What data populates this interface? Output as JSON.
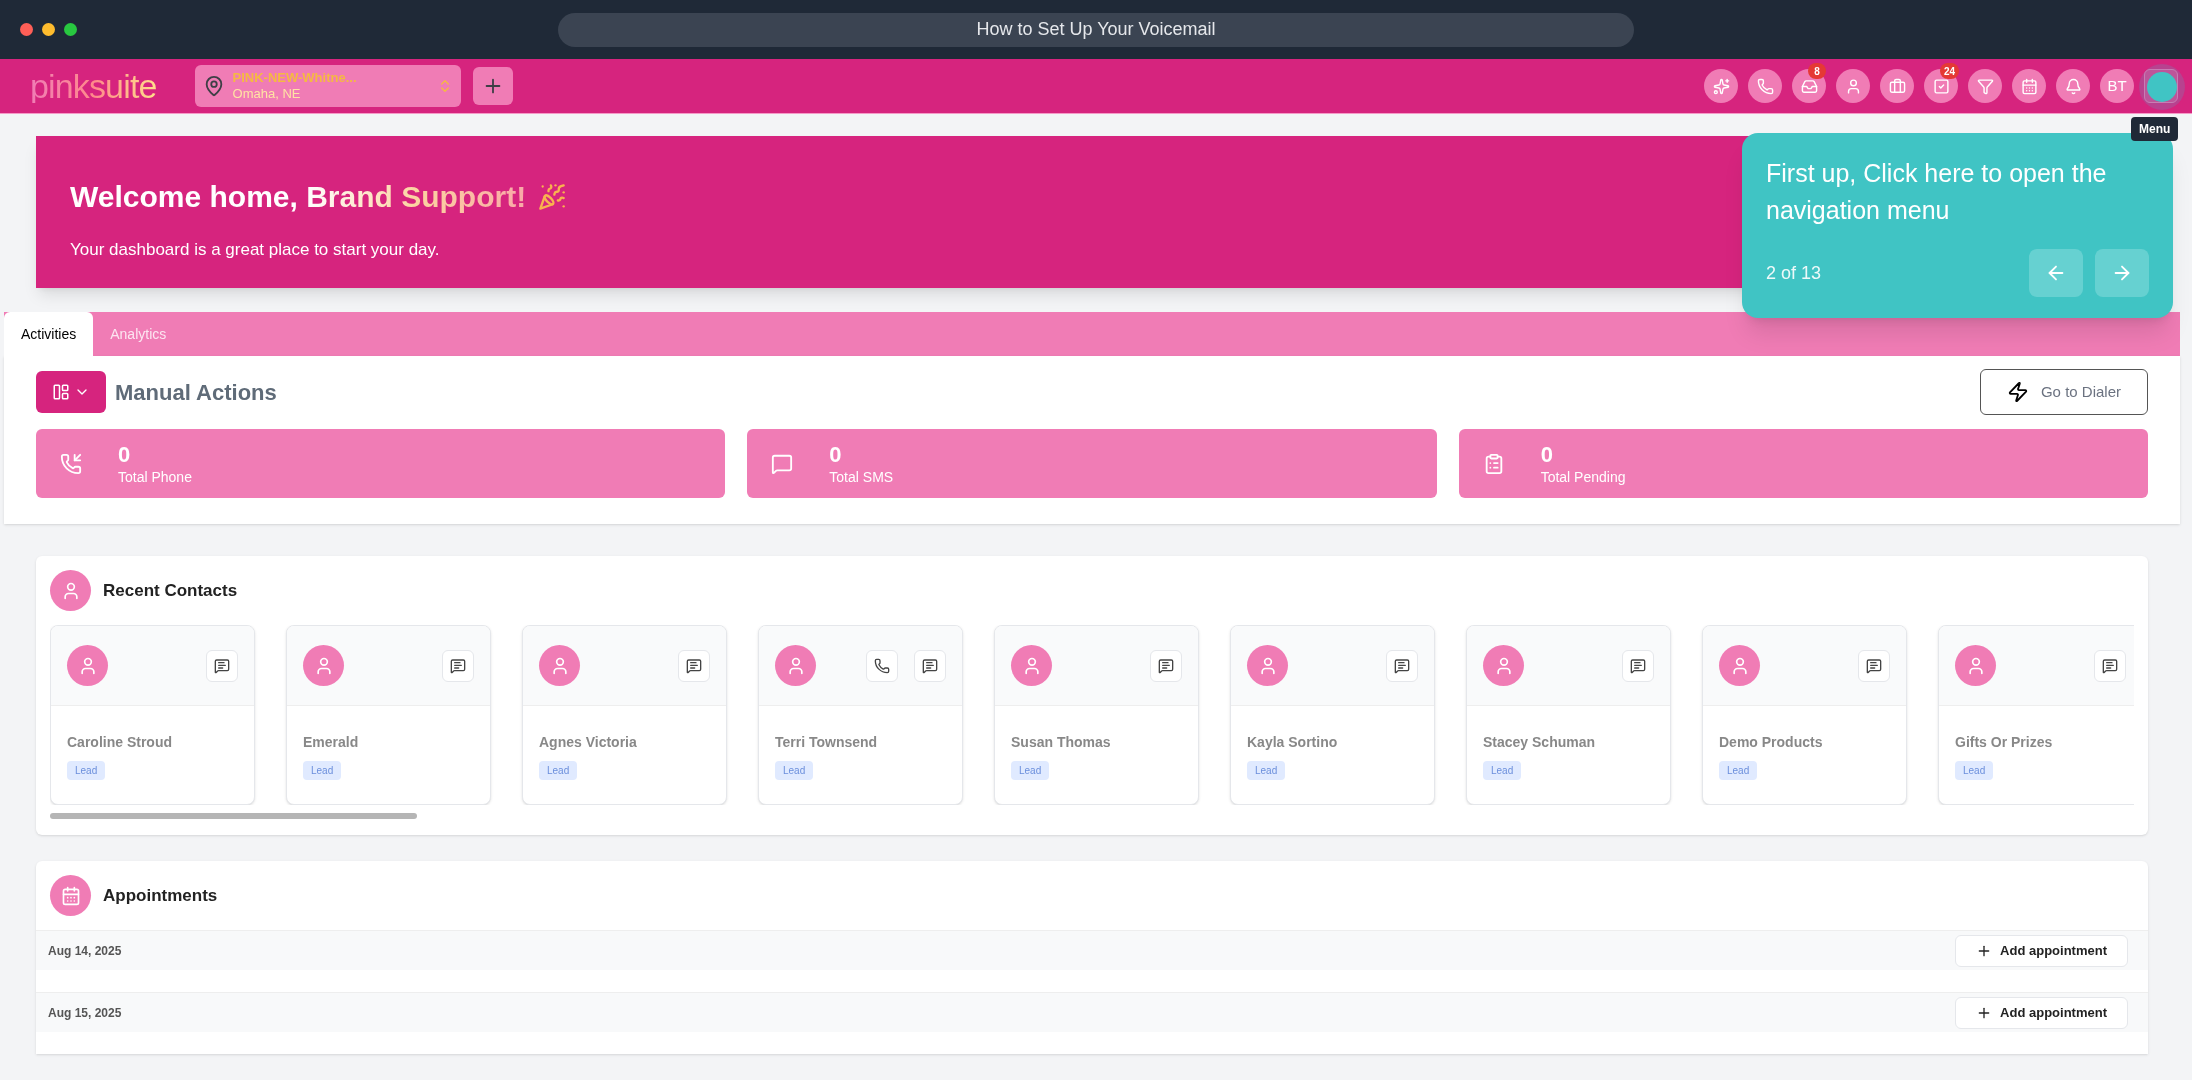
{
  "window": {
    "title": "How to Set Up Your Voicemail"
  },
  "topbar": {
    "logo": "pinksuite",
    "location": {
      "name": "PINK-NEW-Whitne...",
      "city": "Omaha, NE"
    },
    "icons": [
      {
        "kind": "sparkle"
      },
      {
        "kind": "phone"
      },
      {
        "kind": "inbox",
        "badge": "8"
      },
      {
        "kind": "user"
      },
      {
        "kind": "briefcase"
      },
      {
        "kind": "check",
        "badge": "24"
      },
      {
        "kind": "filter"
      },
      {
        "kind": "calendar"
      },
      {
        "kind": "bell"
      },
      {
        "kind": "avatar",
        "text": "BT"
      },
      {
        "kind": "menu"
      }
    ],
    "tooltip": "Menu"
  },
  "banner": {
    "greeting": "Welcome home, ",
    "name": "Brand Support!",
    "subtitle": "Your dashboard is a great place to start your day."
  },
  "tour": {
    "text": "First up, Click here to open the navigation menu",
    "step": "2 of 13"
  },
  "tabs": [
    {
      "label": "Activities",
      "selected": true
    },
    {
      "label": "Analytics",
      "selected": false
    }
  ],
  "manual_actions": {
    "title": "Manual Actions",
    "dialer_button": "Go to Dialer",
    "stats": [
      {
        "kind": "phone",
        "value": "0",
        "label": "Total Phone"
      },
      {
        "kind": "sms",
        "value": "0",
        "label": "Total SMS"
      },
      {
        "kind": "pending",
        "value": "0",
        "label": "Total Pending"
      }
    ]
  },
  "recent_contacts": {
    "title": "Recent Contacts",
    "contacts": [
      {
        "name": "Caroline Stroud",
        "tag": "Lead",
        "phone": false
      },
      {
        "name": "Emerald",
        "tag": "Lead",
        "phone": false
      },
      {
        "name": "Agnes Victoria",
        "tag": "Lead",
        "phone": false
      },
      {
        "name": "Terri Townsend",
        "tag": "Lead",
        "phone": true
      },
      {
        "name": "Susan Thomas",
        "tag": "Lead",
        "phone": false
      },
      {
        "name": "Kayla Sortino",
        "tag": "Lead",
        "phone": false
      },
      {
        "name": "Stacey Schuman",
        "tag": "Lead",
        "phone": false
      },
      {
        "name": "Demo Products",
        "tag": "Lead",
        "phone": false
      },
      {
        "name": "Gifts Or Prizes",
        "tag": "Lead",
        "phone": false
      }
    ]
  },
  "appointments": {
    "title": "Appointments",
    "rows": [
      {
        "date": "Aug 14, 2025",
        "button": "Add appointment"
      },
      {
        "date": "Aug 15, 2025",
        "button": "Add appointment"
      }
    ]
  }
}
